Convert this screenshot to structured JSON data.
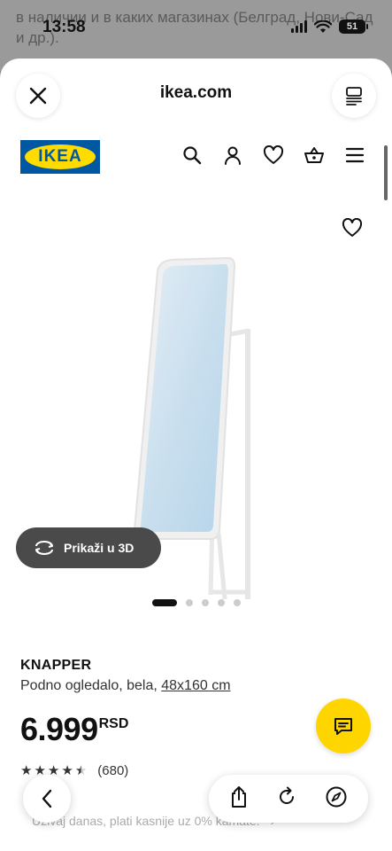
{
  "background_page": {
    "text": "в наличии и в каких магазинах (Белград, Нови-Сад и др.)."
  },
  "status_bar": {
    "time": "13:58",
    "battery": "51"
  },
  "browser": {
    "domain": "ikea.com"
  },
  "site": {
    "logo_text": "IKEA"
  },
  "gallery": {
    "view_3d_label": "Prikaži u 3D",
    "dot_count": 5,
    "active_dot": 0
  },
  "product": {
    "name": "KNAPPER",
    "description": "Podno ogledalo, bela,",
    "size": "48x160 cm",
    "price": "6.999",
    "currency": "RSD",
    "rating": 4.5,
    "review_count": "(680)"
  },
  "promo": {
    "text": "Uživaj danas, plati kasnije uz 0% kamate."
  },
  "colors": {
    "ikea_blue": "#0058a3",
    "ikea_yellow": "#ffdb00",
    "chat_button": "#ffd500"
  }
}
